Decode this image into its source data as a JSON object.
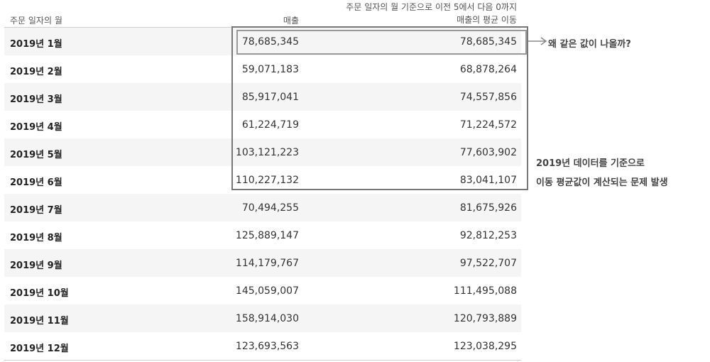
{
  "table": {
    "header": {
      "dimension": "주문 일자의 월",
      "sales": "매출",
      "moving_avg_line1": "주문 일자의 월 기준으로 이전 5에서 다음 0까지",
      "moving_avg_line2": "매출의 평균 이동"
    },
    "rows": [
      {
        "month": "2019년 1월",
        "sales": "78,685,345",
        "moving_avg": "78,685,345"
      },
      {
        "month": "2019년 2월",
        "sales": "59,071,183",
        "moving_avg": "68,878,264"
      },
      {
        "month": "2019년 3월",
        "sales": "85,917,041",
        "moving_avg": "74,557,856"
      },
      {
        "month": "2019년 4월",
        "sales": "61,224,719",
        "moving_avg": "71,224,572"
      },
      {
        "month": "2019년 5월",
        "sales": "103,121,223",
        "moving_avg": "77,603,902"
      },
      {
        "month": "2019년 6월",
        "sales": "110,227,132",
        "moving_avg": "83,041,107"
      },
      {
        "month": "2019년 7월",
        "sales": "70,494,255",
        "moving_avg": "81,675,926"
      },
      {
        "month": "2019년 8월",
        "sales": "125,889,147",
        "moving_avg": "92,812,253"
      },
      {
        "month": "2019년 9월",
        "sales": "114,179,767",
        "moving_avg": "97,522,707"
      },
      {
        "month": "2019년 10월",
        "sales": "145,059,007",
        "moving_avg": "111,495,088"
      },
      {
        "month": "2019년 11월",
        "sales": "158,914,030",
        "moving_avg": "120,793,889"
      },
      {
        "month": "2019년 12월",
        "sales": "123,693,563",
        "moving_avg": "123,038,295"
      }
    ]
  },
  "annotations": {
    "question": "왜 같은 값이 나올까?",
    "problem_line1": "2019년 데이터를 기준으로",
    "problem_line2": "이동 평균값이 계산되는 문제 발생"
  }
}
